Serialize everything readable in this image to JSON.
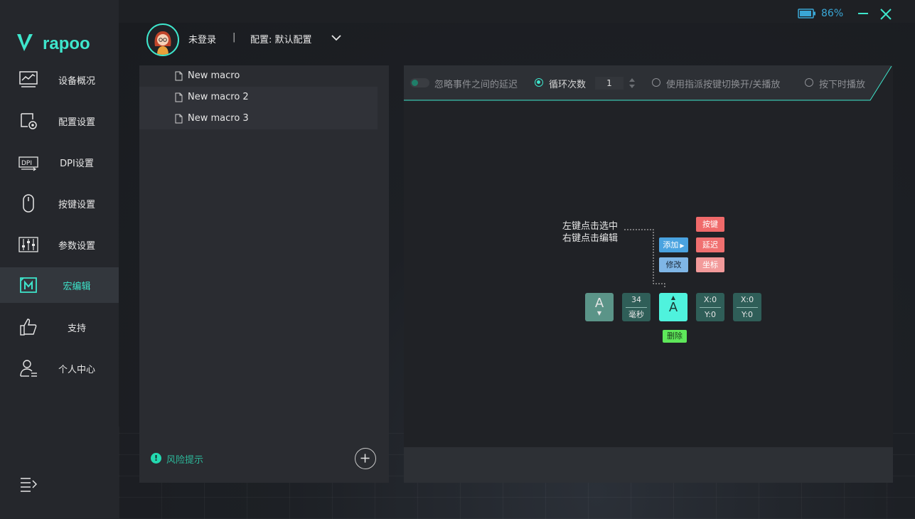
{
  "brand": {
    "name": "rapoo",
    "accent": "#3ee6cc"
  },
  "window": {
    "battery_percent": "86%"
  },
  "user": {
    "name": "未登录",
    "separator": "|",
    "config_label": "配置: 默认配置"
  },
  "sidebar": {
    "items": [
      {
        "label": "设备概况",
        "icon": "monitor-chart-icon"
      },
      {
        "label": "配置设置",
        "icon": "config-gear-icon"
      },
      {
        "label": "DPI设置",
        "icon": "dpi-icon"
      },
      {
        "label": "按键设置",
        "icon": "mouse-icon"
      },
      {
        "label": "参数设置",
        "icon": "sliders-icon"
      },
      {
        "label": "宏编辑",
        "icon": "macro-icon",
        "active": true
      },
      {
        "label": "支持",
        "icon": "thumbs-up-icon"
      },
      {
        "label": "个人中心",
        "icon": "user-icon"
      }
    ]
  },
  "macros": {
    "items": [
      "New macro",
      "New macro 2",
      "New macro 3"
    ],
    "risk_label": "风险提示",
    "risk_icon_text": "!"
  },
  "toolbar": {
    "ignore_delay_label": "忽略事件之间的延迟",
    "loop_label": "循环次数",
    "loop_count": "1",
    "toggle_on_assign_label": "使用指派按键切换开/关播放",
    "play_while_pressed_label": "按下时播放"
  },
  "canvas": {
    "hint_line1": "左键点击选中",
    "hint_line2": "右键点击编辑",
    "add_label": "添加",
    "modify_label": "修改",
    "key_label": "按键",
    "delay_label": "延迟",
    "coord_label": "坐标",
    "delete_label": "删除",
    "events": {
      "key1": "A",
      "delay_value": "34",
      "delay_unit": "毫秒",
      "key2": "A",
      "coord1_x": "X:0",
      "coord1_y": "Y:0",
      "coord2_x": "X:0",
      "coord2_y": "Y:0"
    }
  }
}
